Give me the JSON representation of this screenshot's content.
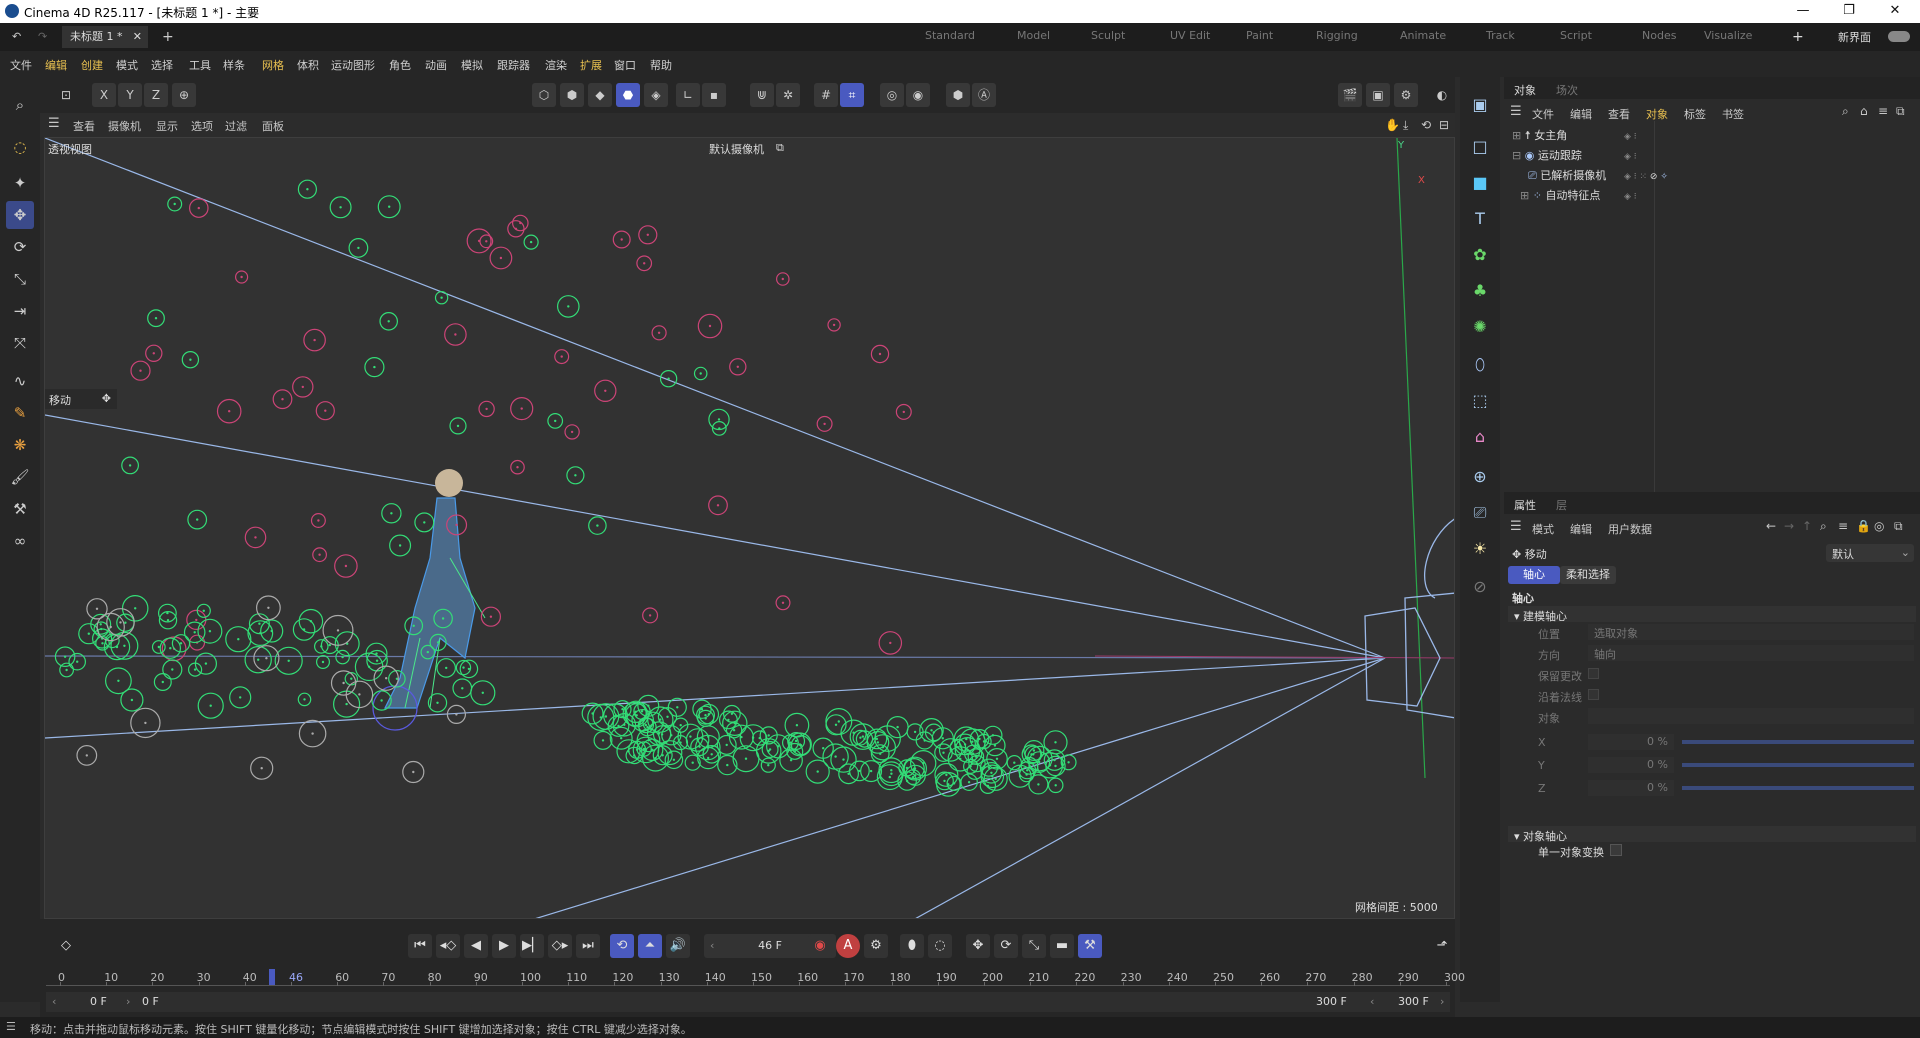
{
  "title_bar": {
    "app_title": "Cinema 4D R25.117 - [未标题 1 *] - 主要"
  },
  "tabs": {
    "doc_tab": "未标题 1 *",
    "add": "+"
  },
  "workspaces": [
    "Standard",
    "Model",
    "Sculpt",
    "UV Edit",
    "Paint",
    "Rigging",
    "Animate",
    "Track",
    "Script",
    "Nodes",
    "Visualize"
  ],
  "new_layout": "新界面",
  "menu": [
    "文件",
    "编辑",
    "创建",
    "模式",
    "选择",
    "工具",
    "样条",
    "网格",
    "体积",
    "运动图形",
    "角色",
    "动画",
    "模拟",
    "跟踪器",
    "渲染",
    "扩展",
    "窗口",
    "帮助"
  ],
  "axis_toggles": [
    "X",
    "Y",
    "Z"
  ],
  "viewport": {
    "menu": [
      "查看",
      "摄像机",
      "显示",
      "选项",
      "过滤",
      "面板"
    ],
    "view_name": "透视视图",
    "camera_name": "默认摄像机",
    "grid_spacing": "网格间距 : 5000 cm",
    "tool_label": "移动",
    "axis_y": "Y",
    "axis_x": "X"
  },
  "object_panel": {
    "tabs": [
      "对象",
      "场次"
    ],
    "menu": [
      "文件",
      "编辑",
      "查看",
      "对象",
      "标签",
      "书签"
    ],
    "items": [
      {
        "name": "女主角"
      },
      {
        "name": "运动跟踪"
      },
      {
        "name": "已解析摄像机"
      },
      {
        "name": "自动特征点"
      }
    ]
  },
  "attr_panel": {
    "tabs": [
      "属性",
      "层"
    ],
    "menu": [
      "模式",
      "编辑",
      "用户数据"
    ],
    "tool_name": "移动",
    "preset": "默认",
    "subtabs": [
      "轴心",
      "柔和选择"
    ],
    "section": "轴心",
    "group1": "建模轴心",
    "fields": [
      {
        "label": "位置",
        "value": "选取对象"
      },
      {
        "label": "方向",
        "value": "轴向"
      },
      {
        "label": "保留更改",
        "value": ""
      },
      {
        "label": "沿着法线",
        "value": ""
      },
      {
        "label": "对象",
        "value": ""
      }
    ],
    "xyz": [
      {
        "label": "X",
        "value": "0 %"
      },
      {
        "label": "Y",
        "value": "0 %"
      },
      {
        "label": "Z",
        "value": "0 %"
      }
    ],
    "group2": "对象轴心",
    "single_obj": "单一对象变换"
  },
  "timeline": {
    "current_frame": "46 F",
    "ticks": [
      "0",
      "10",
      "20",
      "30",
      "40",
      "46",
      "60",
      "70",
      "80",
      "90",
      "100",
      "110",
      "120",
      "130",
      "140",
      "150",
      "160",
      "170",
      "180",
      "190",
      "200",
      "210",
      "220",
      "230",
      "240",
      "250",
      "260",
      "270",
      "280",
      "290",
      "300"
    ],
    "start": "0 F",
    "start2": "0 F",
    "end": "300 F",
    "end2": "300 F"
  },
  "status": "移动：点击并拖动鼠标移动元素。按住 SHIFT 键量化移动；节点编辑模式时按住 SHIFT 键增加选择对象；按住 CTRL 键减少选择对象。",
  "colors": {
    "accent": "#4a5ac0",
    "track_green": "#33dd77",
    "track_pink": "#cc4477",
    "camera_lines": "#9ab8e8"
  }
}
